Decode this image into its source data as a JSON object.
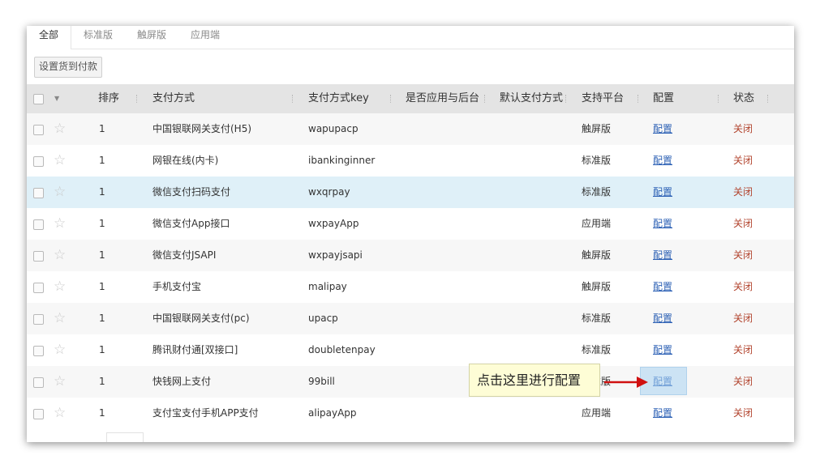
{
  "tabs": [
    "全部",
    "标准版",
    "触屏版",
    "应用端"
  ],
  "toolbar": {
    "set_cod_label": "设置货到付款"
  },
  "columns": {
    "sort": "排序",
    "method": "支付方式",
    "key": "支付方式key",
    "backend": "是否应用与后台",
    "default": "默认支付方式",
    "platform": "支持平台",
    "config": "配置",
    "status": "状态"
  },
  "rows": [
    {
      "sort": "1",
      "method": "中国银联网关支付(H5)",
      "key": "wapupacp",
      "platform": "触屏版",
      "config": "配置",
      "status": "关闭"
    },
    {
      "sort": "1",
      "method": "网银在线(内卡)",
      "key": "ibankinginner",
      "platform": "标准版",
      "config": "配置",
      "status": "关闭"
    },
    {
      "sort": "1",
      "method": "微信支付扫码支付",
      "key": "wxqrpay",
      "platform": "标准版",
      "config": "配置",
      "status": "关闭"
    },
    {
      "sort": "1",
      "method": "微信支付App接口",
      "key": "wxpayApp",
      "platform": "应用端",
      "config": "配置",
      "status": "关闭"
    },
    {
      "sort": "1",
      "method": "微信支付JSAPI",
      "key": "wxpayjsapi",
      "platform": "触屏版",
      "config": "配置",
      "status": "关闭"
    },
    {
      "sort": "1",
      "method": "手机支付宝",
      "key": "malipay",
      "platform": "触屏版",
      "config": "配置",
      "status": "关闭"
    },
    {
      "sort": "1",
      "method": "中国银联网关支付(pc)",
      "key": "upacp",
      "platform": "标准版",
      "config": "配置",
      "status": "关闭"
    },
    {
      "sort": "1",
      "method": "腾讯财付通[双接口]",
      "key": "doubletenpay",
      "platform": "标准版",
      "config": "配置",
      "status": "关闭"
    },
    {
      "sort": "1",
      "method": "快钱网上支付",
      "key": "99bill",
      "platform": "标准版",
      "config": "配置",
      "status": "关闭"
    },
    {
      "sort": "1",
      "method": "支付宝支付手机APP支付",
      "key": "alipayApp",
      "platform": "应用端",
      "config": "配置",
      "status": "关闭"
    }
  ],
  "callout": {
    "text": "点击这里进行配置"
  },
  "colors": {
    "link": "#2d61b5",
    "status": "#b2442e",
    "highlight_row": "#dff0f8",
    "arrow": "#d01010"
  },
  "icons": {
    "row_favorite": "star-outline-icon",
    "header_menu": "caret-down-icon"
  }
}
